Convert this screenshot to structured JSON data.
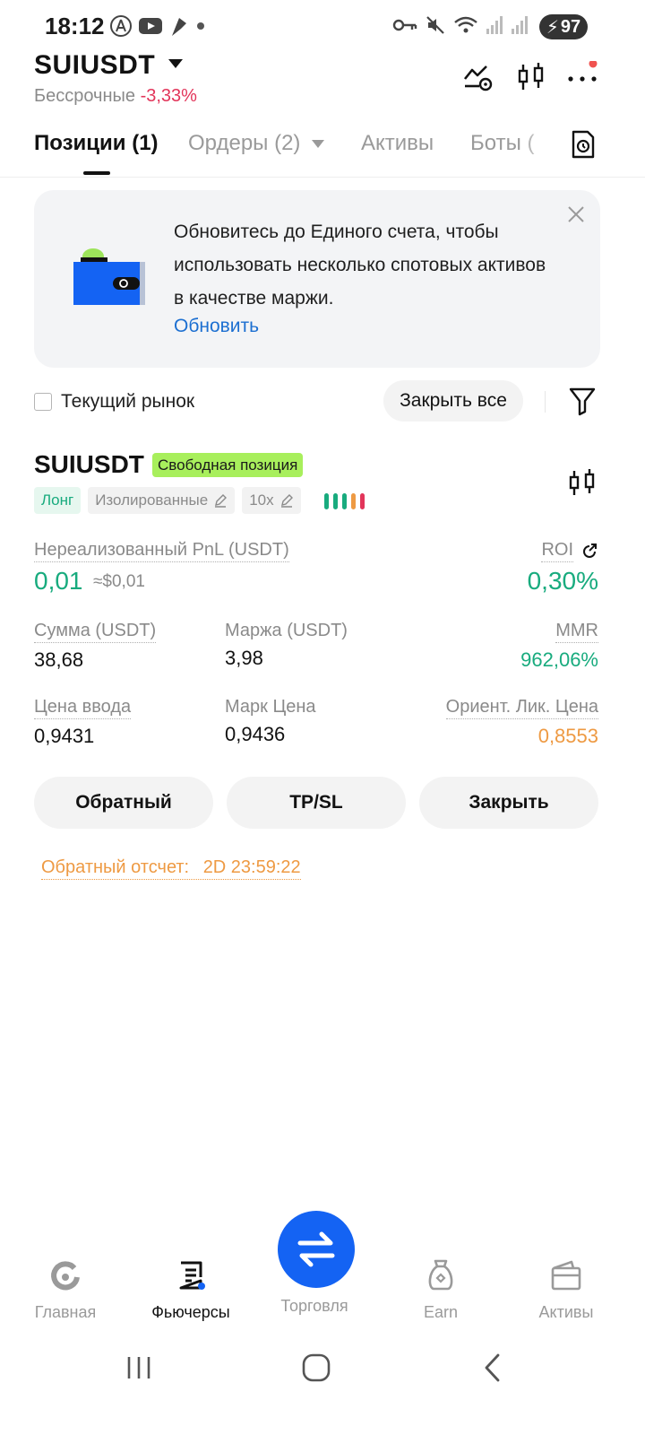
{
  "status_bar": {
    "time": "18:12",
    "battery": "97"
  },
  "header": {
    "symbol": "SUIUSDT",
    "market_type": "Бессрочные",
    "change": "-3,33%"
  },
  "tabs": [
    {
      "label": "Позиции (1)"
    },
    {
      "label": "Ордеры (2)"
    },
    {
      "label": "Активы"
    },
    {
      "label": "Боты ("
    }
  ],
  "promo": {
    "text": "Обновитесь до Единого счета, чтобы использовать несколько спотовых активов в качестве маржи.",
    "link": "Обновить"
  },
  "filter": {
    "checkbox_label": "Текущий рынок",
    "close_all": "Закрыть все"
  },
  "position": {
    "symbol": "SUIUSDT",
    "badge": "Свободная позиция",
    "side": "Лонг",
    "margin_mode": "Изолированные",
    "leverage": "10x",
    "risk_colors": [
      "#18ab7e",
      "#18ab7e",
      "#18ab7e",
      "#ee9a43",
      "#e2355a"
    ],
    "pnl_label": "Нереализованный PnL (USDT)",
    "pnl_value": "0,01",
    "pnl_usd": "≈$0,01",
    "roi_label": "ROI",
    "roi_value": "0,30%",
    "size_label": "Сумма (USDT)",
    "size_value": "38,68",
    "margin_label": "Маржа (USDT)",
    "margin_value": "3,98",
    "mmr_label": "MMR",
    "mmr_value": "962,06%",
    "entry_label": "Цена ввода",
    "entry_value": "0,9431",
    "mark_label": "Марк Цена",
    "mark_value": "0,9436",
    "liq_label": "Ориент. Лик. Цена",
    "liq_value": "0,8553",
    "buttons": {
      "reverse": "Обратный",
      "tpsl": "TP/SL",
      "close": "Закрыть"
    },
    "countdown_label": "Обратный отсчет:",
    "countdown_value": "2D 23:59:22"
  },
  "bottom_nav": [
    {
      "label": "Главная",
      "icon": "home-icon"
    },
    {
      "label": "Фьючерсы",
      "icon": "futures-icon"
    },
    {
      "label": "Торговля",
      "icon": "trade-swap-icon"
    },
    {
      "label": "Earn",
      "icon": "earn-icon"
    },
    {
      "label": "Активы",
      "icon": "wallet-icon"
    }
  ],
  "colors": {
    "green": "#18ab7e",
    "red": "#e2355a",
    "orange": "#ee9a43",
    "blue": "#1463f3",
    "link": "#1c6fd1",
    "badge": "#a8ef5c"
  }
}
